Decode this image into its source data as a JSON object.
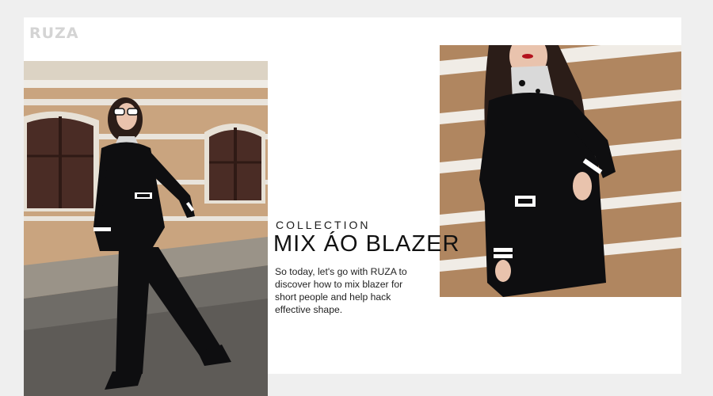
{
  "brand": {
    "logo_text": "RUZA"
  },
  "hero": {
    "eyebrow": "COLLECTION",
    "title": "MIX ÁO BLAZER",
    "description": "So today, let's go with RUZA to discover how to mix blazer for short people and help hack effective shape."
  },
  "colors": {
    "page_background": "#efefef",
    "card_background": "#ffffff",
    "logo": "#d4d4d4",
    "text": "#111111",
    "wall": "#c9a47f",
    "outfit": "#0e0e10"
  }
}
